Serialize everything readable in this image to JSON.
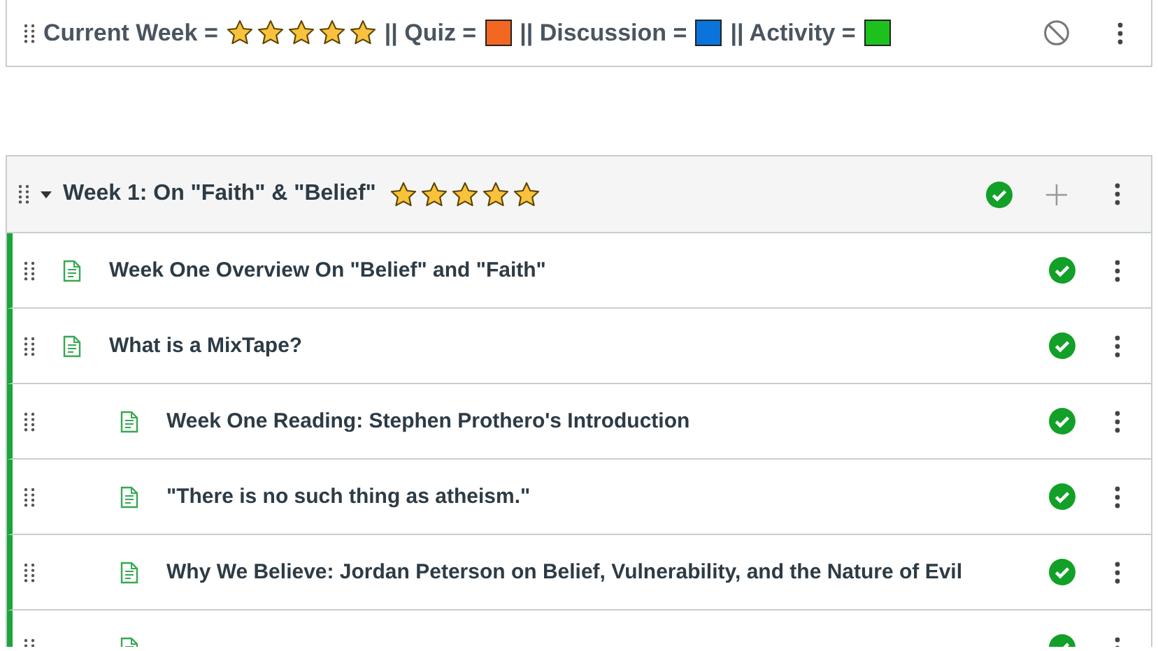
{
  "legend": {
    "published": false,
    "parts": [
      {
        "kind": "stars",
        "label": "Current Week =",
        "stars": 5
      },
      {
        "kind": "swatch",
        "label": "|| Quiz =",
        "color": "#f26722"
      },
      {
        "kind": "swatch",
        "label": "|| Discussion =",
        "color": "#0a74da"
      },
      {
        "kind": "swatch",
        "label": "|| Activity =",
        "color": "#1dc11d"
      }
    ]
  },
  "module": {
    "title": "Week 1: On \"Faith\" & \"Belief\"",
    "stars": 5,
    "expanded": true,
    "published": true,
    "items": [
      {
        "title": "Week One Overview On \"Belief\" and \"Faith\"",
        "published": true
      },
      {
        "title": "What is a MixTape?",
        "published": true,
        "children": [
          {
            "title": "Week One Reading: Stephen Prothero's Introduction",
            "published": true
          },
          {
            "title": "\"There is no such thing as atheism.\"",
            "published": true
          },
          {
            "title": "Why We Believe: Jordan Peterson on Belief, Vulnerability, and the Nature of Evil",
            "published": true
          },
          {
            "published": true
          }
        ]
      }
    ]
  }
}
